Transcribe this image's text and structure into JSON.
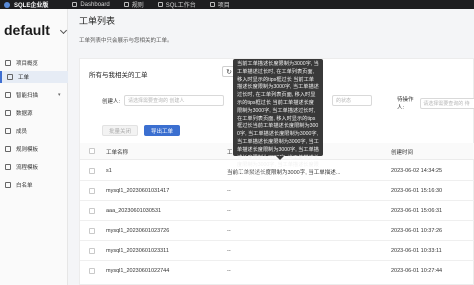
{
  "topbar": {
    "brand": "SQLE企业版",
    "nav": [
      {
        "label": "Dashboard",
        "icon": "dashboard-icon"
      },
      {
        "label": "规则",
        "icon": "rules-icon"
      },
      {
        "label": "SQL工作台",
        "icon": "workbench-icon"
      },
      {
        "label": "项目",
        "icon": "project-icon"
      }
    ]
  },
  "sidebar": {
    "project": "default",
    "items": [
      {
        "label": "项目概览",
        "icon": "overview-icon"
      },
      {
        "label": "工单",
        "icon": "ticket-icon"
      },
      {
        "label": "智能扫描",
        "icon": "scan-icon"
      },
      {
        "label": "数据源",
        "icon": "datasource-icon"
      },
      {
        "label": "成员",
        "icon": "member-icon"
      },
      {
        "label": "规则模板",
        "icon": "template-icon"
      },
      {
        "label": "流程模板",
        "icon": "workflow-icon"
      },
      {
        "label": "白名单",
        "icon": "whitelist-icon"
      }
    ]
  },
  "page": {
    "title": "工单列表",
    "description": "工单列表中只会展示与您相关的工单。"
  },
  "card": {
    "title": "所有与我相关的工单",
    "filters": [
      {
        "label": "创建人:",
        "placeholder": "请选择需要查询的 创建人"
      },
      {
        "label": "",
        "placeholder": "的状态"
      },
      {
        "label": "待操作人:",
        "placeholder": "请选择需要查询的 待"
      }
    ],
    "buttons": {
      "batch_close": "批量关闭",
      "export": "导出工单"
    },
    "columns": {
      "name": "工单名称",
      "desc": "工",
      "created": "创建时间"
    },
    "rows": [
      {
        "name": "s1",
        "desc": "当前工单描述长度限制为3000字, 当工单描述...",
        "created": "2023-06-02 14:34:25"
      },
      {
        "name": "mysql1_20230601031417",
        "desc": "--",
        "created": "2023-06-01 15:16:30"
      },
      {
        "name": "aaa_20230601030531",
        "desc": "--",
        "created": "2023-06-01 15:06:31"
      },
      {
        "name": "mysql1_20230601023726",
        "desc": "--",
        "created": "2023-06-01 10:37:26"
      },
      {
        "name": "mysql1_20230601023311",
        "desc": "--",
        "created": "2023-06-01 10:33:11"
      },
      {
        "name": "mysql1_20230601022744",
        "desc": "--",
        "created": "2023-06-01 10:27:44"
      }
    ]
  },
  "tooltip": {
    "text": "当前工单描述长度限制为3000字, 当工单描述过长时, 在工单列表页面, 移入时显示的tips框过长 当前工单描述长度限制为3000字, 当工单描述过长时, 在工单列表页面, 移入时显示的tips框过长 当前工单描述长度限制为3000字, 当工单描述过长时, 在工单列表页面, 移入时显示的tips框过长当前工单描述长度限制为3000字, 当工单描述长度限制为3000字, 当工单描述长度限制为3000字, 当工单描述长度限制为3000字, 当工单描述长度限制为3000字, 当工单描述长度限制为3000字, 当工单描述长度限制为3000字"
  }
}
